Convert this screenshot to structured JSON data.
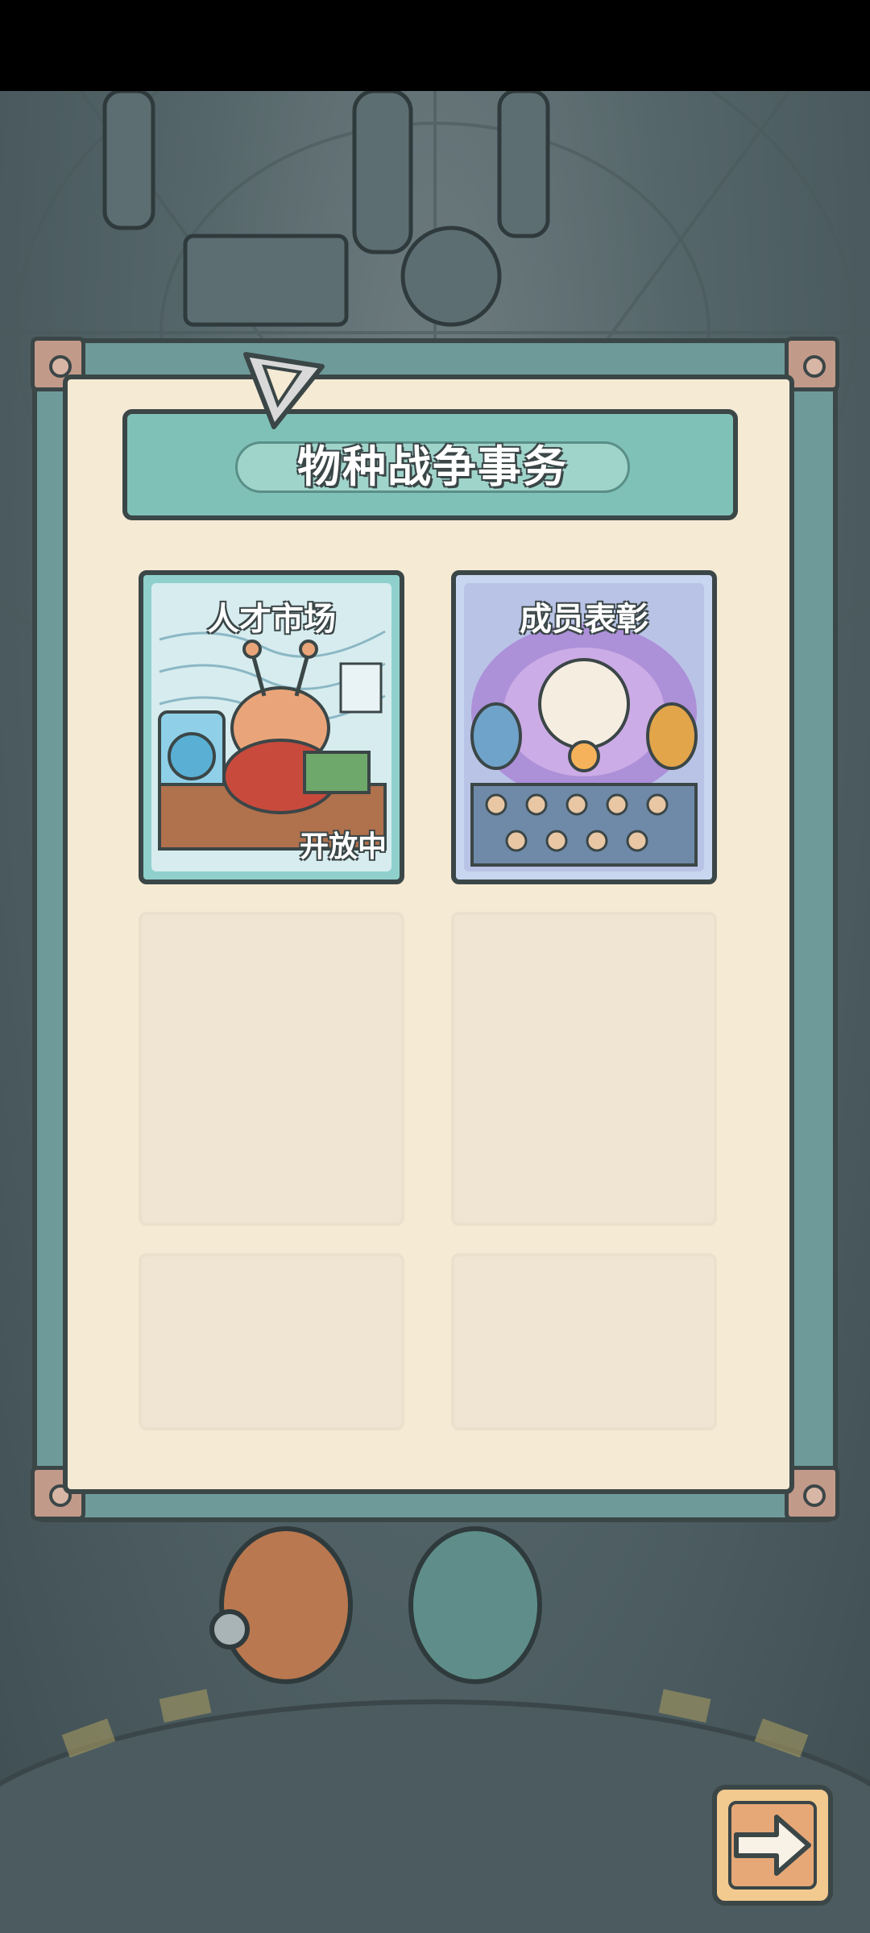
{
  "screen": {
    "title": "物种战争事务"
  },
  "cards": [
    {
      "label": "人才市场",
      "status": "开放中",
      "theme": "#8fd0cd"
    },
    {
      "label": "成员表彰",
      "status": "",
      "theme": "#c8d6ef"
    }
  ],
  "empty_slots": 4,
  "icons": {
    "pin": "triangle-pin-icon",
    "next": "arrow-right-icon"
  },
  "colors": {
    "panel_teal": "#6e9a9a",
    "parchment": "#f5ead4",
    "outline": "#3b4647",
    "button_orange": "#f2c98f"
  }
}
